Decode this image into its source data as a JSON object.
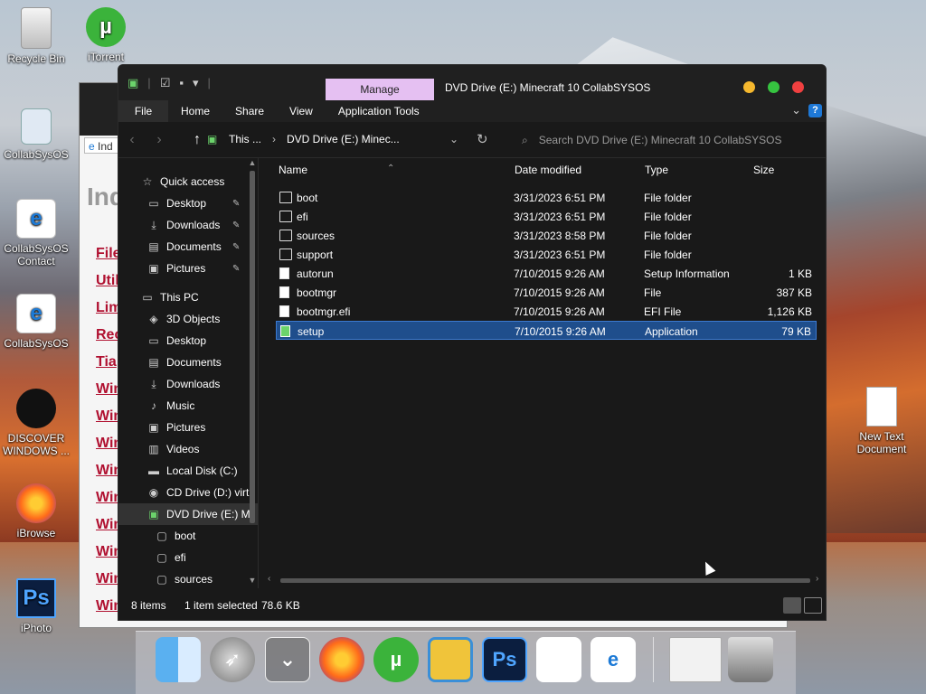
{
  "desktop": {
    "icons": [
      {
        "label": "Recycle Bin",
        "icon": "recycle-bin-icon"
      },
      {
        "label": "iTorrent",
        "icon": "utorrent-icon"
      },
      {
        "label": "CollabSysOS",
        "icon": "folder-icon"
      },
      {
        "label": "CollabSysOS Contact",
        "icon": "internet-explorer-icon"
      },
      {
        "label": "CollabSysOS",
        "icon": "internet-explorer-icon"
      },
      {
        "label": "DISCOVER WINDOWS ...",
        "icon": "apple-icon"
      },
      {
        "label": "iBrowse",
        "icon": "firefox-icon"
      },
      {
        "label": "iPhoto",
        "icon": "photoshop-icon"
      },
      {
        "label": "New Text Document",
        "icon": "text-document-icon"
      }
    ]
  },
  "background_window": {
    "tab_label": "Ind",
    "heading": "Ind",
    "links": [
      "File",
      "Util",
      "Lim",
      "Rec",
      "Tia",
      "Win",
      "Win",
      "Win",
      "Win",
      "Win",
      "Win",
      "Win",
      "Win",
      "Win"
    ]
  },
  "explorer": {
    "title": "DVD Drive (E:) Minecraft 10 CollabSYSOS",
    "manage_tab": "Manage",
    "ribbon_tabs": [
      "File",
      "Home",
      "Share",
      "View",
      "Application Tools"
    ],
    "breadcrumb": [
      "This ...",
      "DVD Drive (E:) Minec..."
    ],
    "search_placeholder": "Search DVD Drive (E:) Minecraft 10 CollabSYSOS",
    "nav_items": [
      {
        "label": "Quick access",
        "icon": "star-icon",
        "pinned": false,
        "indent": 0
      },
      {
        "label": "Desktop",
        "icon": "desktop-icon",
        "pinned": true,
        "indent": 1
      },
      {
        "label": "Downloads",
        "icon": "download-icon",
        "pinned": true,
        "indent": 1
      },
      {
        "label": "Documents",
        "icon": "documents-icon",
        "pinned": true,
        "indent": 1
      },
      {
        "label": "Pictures",
        "icon": "pictures-icon",
        "pinned": true,
        "indent": 1
      },
      {
        "label": "This PC",
        "icon": "pc-icon",
        "pinned": false,
        "indent": 0
      },
      {
        "label": "3D Objects",
        "icon": "cube-icon",
        "pinned": false,
        "indent": 1
      },
      {
        "label": "Desktop",
        "icon": "desktop-icon",
        "pinned": false,
        "indent": 1
      },
      {
        "label": "Documents",
        "icon": "documents-icon",
        "pinned": false,
        "indent": 1
      },
      {
        "label": "Downloads",
        "icon": "download-icon",
        "pinned": false,
        "indent": 1
      },
      {
        "label": "Music",
        "icon": "music-icon",
        "pinned": false,
        "indent": 1
      },
      {
        "label": "Pictures",
        "icon": "pictures-icon",
        "pinned": false,
        "indent": 1
      },
      {
        "label": "Videos",
        "icon": "videos-icon",
        "pinned": false,
        "indent": 1
      },
      {
        "label": "Local Disk (C:)",
        "icon": "disk-icon",
        "pinned": false,
        "indent": 1
      },
      {
        "label": "CD Drive (D:) virt",
        "icon": "cd-icon",
        "pinned": false,
        "indent": 1
      },
      {
        "label": "DVD Drive (E:) M",
        "icon": "dvd-icon",
        "pinned": false,
        "indent": 1
      },
      {
        "label": "boot",
        "icon": "folder-icon",
        "pinned": false,
        "indent": 2
      },
      {
        "label": "efi",
        "icon": "folder-icon",
        "pinned": false,
        "indent": 2
      },
      {
        "label": "sources",
        "icon": "folder-icon",
        "pinned": false,
        "indent": 2
      }
    ],
    "columns": {
      "name": "Name",
      "date": "Date modified",
      "type": "Type",
      "size": "Size"
    },
    "files": [
      {
        "name": "boot",
        "date": "3/31/2023 6:51 PM",
        "type": "File folder",
        "size": "",
        "kind": "folder"
      },
      {
        "name": "efi",
        "date": "3/31/2023 6:51 PM",
        "type": "File folder",
        "size": "",
        "kind": "folder"
      },
      {
        "name": "sources",
        "date": "3/31/2023 8:58 PM",
        "type": "File folder",
        "size": "",
        "kind": "folder"
      },
      {
        "name": "support",
        "date": "3/31/2023 6:51 PM",
        "type": "File folder",
        "size": "",
        "kind": "folder"
      },
      {
        "name": "autorun",
        "date": "7/10/2015 9:26 AM",
        "type": "Setup Information",
        "size": "1 KB",
        "kind": "file"
      },
      {
        "name": "bootmgr",
        "date": "7/10/2015 9:26 AM",
        "type": "File",
        "size": "387 KB",
        "kind": "file"
      },
      {
        "name": "bootmgr.efi",
        "date": "7/10/2015 9:26 AM",
        "type": "EFI File",
        "size": "1,126 KB",
        "kind": "file"
      },
      {
        "name": "setup",
        "date": "7/10/2015 9:26 AM",
        "type": "Application",
        "size": "79 KB",
        "kind": "app",
        "selected": true
      }
    ],
    "status": {
      "count": "8 items",
      "selection": "1 item selected",
      "size": "78.6 KB"
    }
  },
  "dock": {
    "items": [
      "finder-icon",
      "launchpad-icon",
      "downloads-stack-icon",
      "firefox-icon",
      "utorrent-icon",
      "package-icon",
      "photoshop-icon",
      "apple-icon",
      "internet-explorer-icon",
      "window-preview-icon",
      "trash-icon"
    ]
  },
  "colors": {
    "selection": "#1f4e8c",
    "manage_tab": "#e5c0f2",
    "close": "#f04040",
    "minimize": "#f5b82e",
    "maximize": "#36c440",
    "link": "#b01030"
  }
}
